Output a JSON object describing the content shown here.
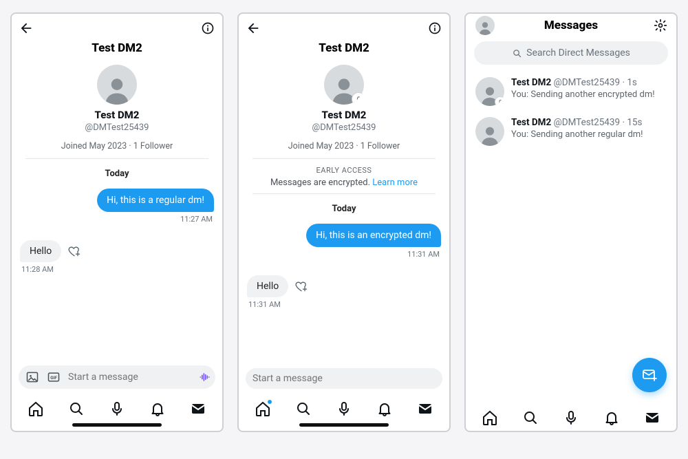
{
  "phones": [
    {
      "header_title": "Test DM2",
      "profile": {
        "name": "Test DM2",
        "handle": "@DMTest25439",
        "meta": "Joined May 2023 · 1 Follower",
        "has_lock": false
      },
      "encrypted_notice": null,
      "day_label": "Today",
      "messages": [
        {
          "dir": "out",
          "text": "Hi, this is a regular dm!",
          "ts": "11:27 AM"
        },
        {
          "dir": "in",
          "text": "Hello",
          "ts": "11:28 AM"
        }
      ],
      "composer": {
        "placeholder": "Start a message",
        "show_media_icons": true,
        "show_voice": true
      },
      "home_dot": false
    },
    {
      "header_title": "Test DM2",
      "profile": {
        "name": "Test DM2",
        "handle": "@DMTest25439",
        "meta": "Joined May 2023 · 1 Follower",
        "has_lock": true
      },
      "encrypted_notice": {
        "eyebrow": "EARLY ACCESS",
        "text": "Messages are encrypted.",
        "link": "Learn more"
      },
      "day_label": "Today",
      "messages": [
        {
          "dir": "out",
          "text": "Hi, this is an encrypted dm!",
          "ts": "11:31 AM"
        },
        {
          "dir": "in",
          "text": "Hello",
          "ts": "11:31 AM"
        }
      ],
      "composer": {
        "placeholder": "Start a message",
        "show_media_icons": false,
        "show_voice": false
      },
      "home_dot": true
    },
    {
      "title": "Messages",
      "search_placeholder": "Search Direct Messages",
      "conversations": [
        {
          "name": "Test DM2",
          "handle": "@DMTest25439",
          "age": "1s",
          "preview": "You: Sending another encrypted dm!",
          "has_lock": true
        },
        {
          "name": "Test DM2",
          "handle": "@DMTest25439",
          "age": "15s",
          "preview": "You: Sending another regular dm!",
          "has_lock": false
        }
      ]
    }
  ]
}
